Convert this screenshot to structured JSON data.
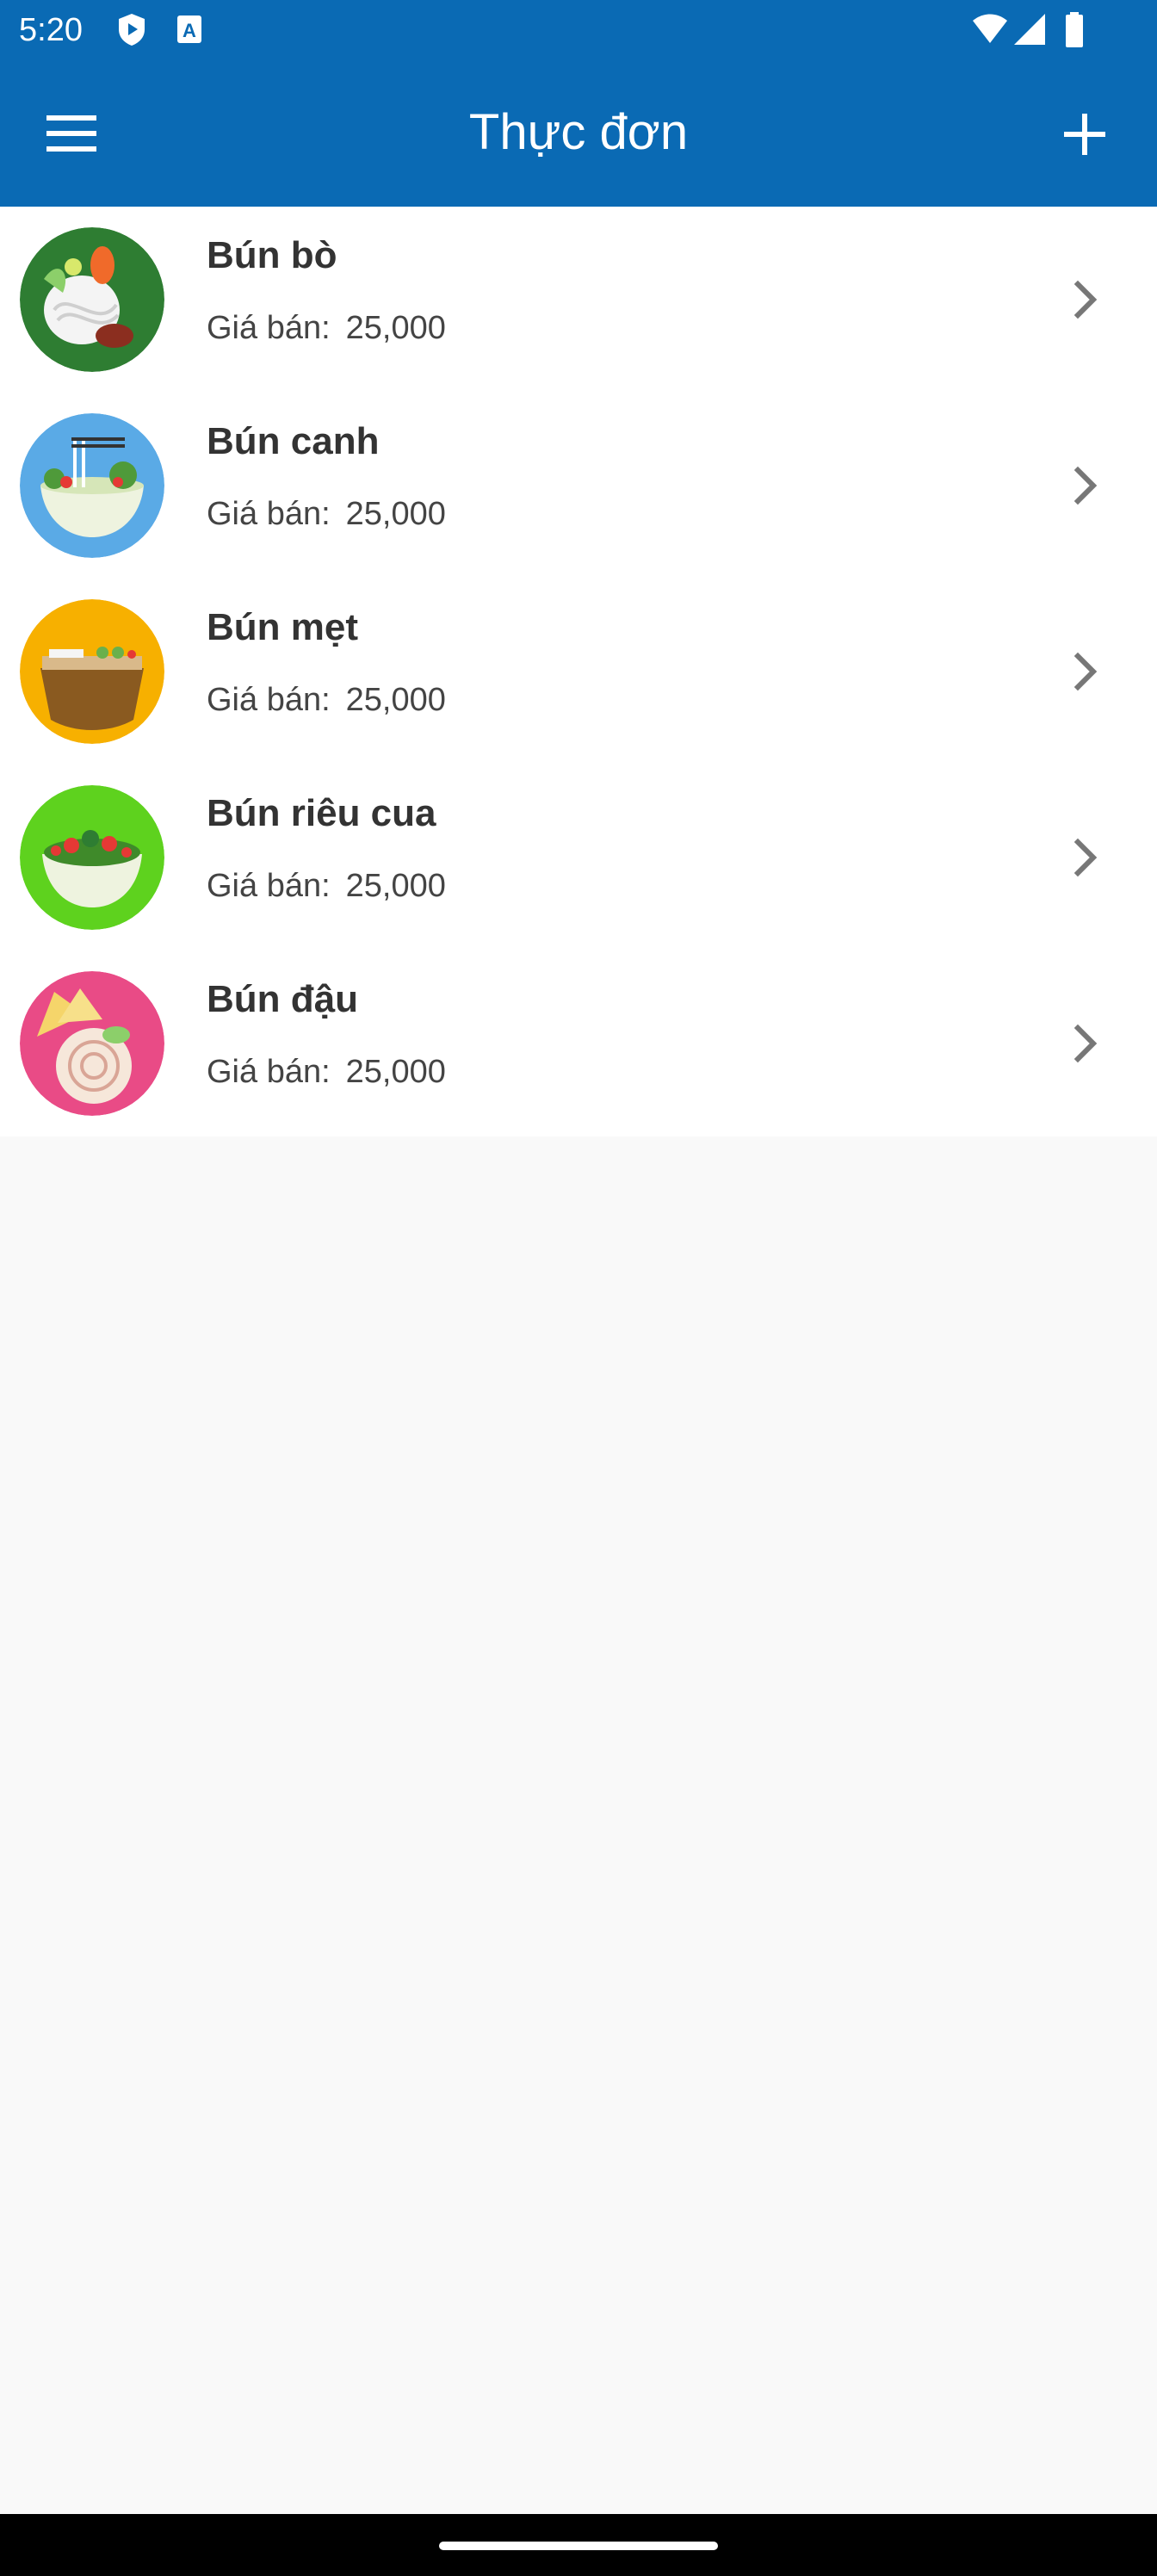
{
  "status_bar": {
    "time": "5:20",
    "icons": [
      "shield-play-icon",
      "a-badge-icon",
      "wifi-icon",
      "signal-icon",
      "battery-icon"
    ]
  },
  "app_bar": {
    "title": "Thực đơn",
    "left_icon": "hamburger-menu-icon",
    "right_icon": "plus-icon",
    "color": "#0a6ab4"
  },
  "menu_items": [
    {
      "name": "Bún bò",
      "price_label": "Giá bán:",
      "price": "25,000",
      "avatar_color": "#2e7d32"
    },
    {
      "name": "Bún canh",
      "price_label": "Giá bán:",
      "price": "25,000",
      "avatar_color": "#5aaae6"
    },
    {
      "name": "Bún mẹt",
      "price_label": "Giá bán:",
      "price": "25,000",
      "avatar_color": "#f7b000"
    },
    {
      "name": "Bún riêu cua",
      "price_label": "Giá bán:",
      "price": "25,000",
      "avatar_color": "#5ed21e"
    },
    {
      "name": "Bún đậu",
      "price_label": "Giá bán:",
      "price": "25,000",
      "avatar_color": "#e94b86"
    }
  ]
}
